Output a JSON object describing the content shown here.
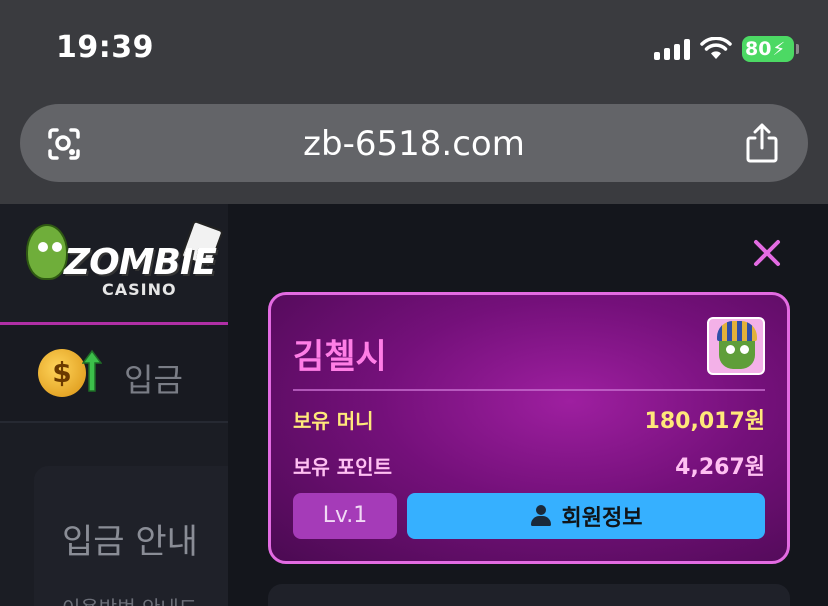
{
  "status_bar": {
    "time": "19:39",
    "battery": "80",
    "icons": [
      "signal-icon",
      "wifi-icon",
      "battery-charging-icon"
    ]
  },
  "browser": {
    "url": "zb-6518.com",
    "icons": [
      "lens-icon",
      "share-icon"
    ]
  },
  "sidebar": {
    "logo": "ZOMBIE CASINO",
    "deposit_label": "입금",
    "guide_title": "입금 안내",
    "guide_sub": "이용방법 안내드"
  },
  "profile": {
    "name": "김첼시",
    "money_label": "보유 머니",
    "money_value": "180,017원",
    "points_label": "보유 포인트",
    "points_value": "4,267원",
    "level": "Lv.1",
    "member_info_label": "회원정보"
  },
  "colors": {
    "accent_pink": "#e36be2",
    "card_purple": "#74107a",
    "button_blue": "#36b0ff",
    "money_yellow": "#ffe87a"
  }
}
